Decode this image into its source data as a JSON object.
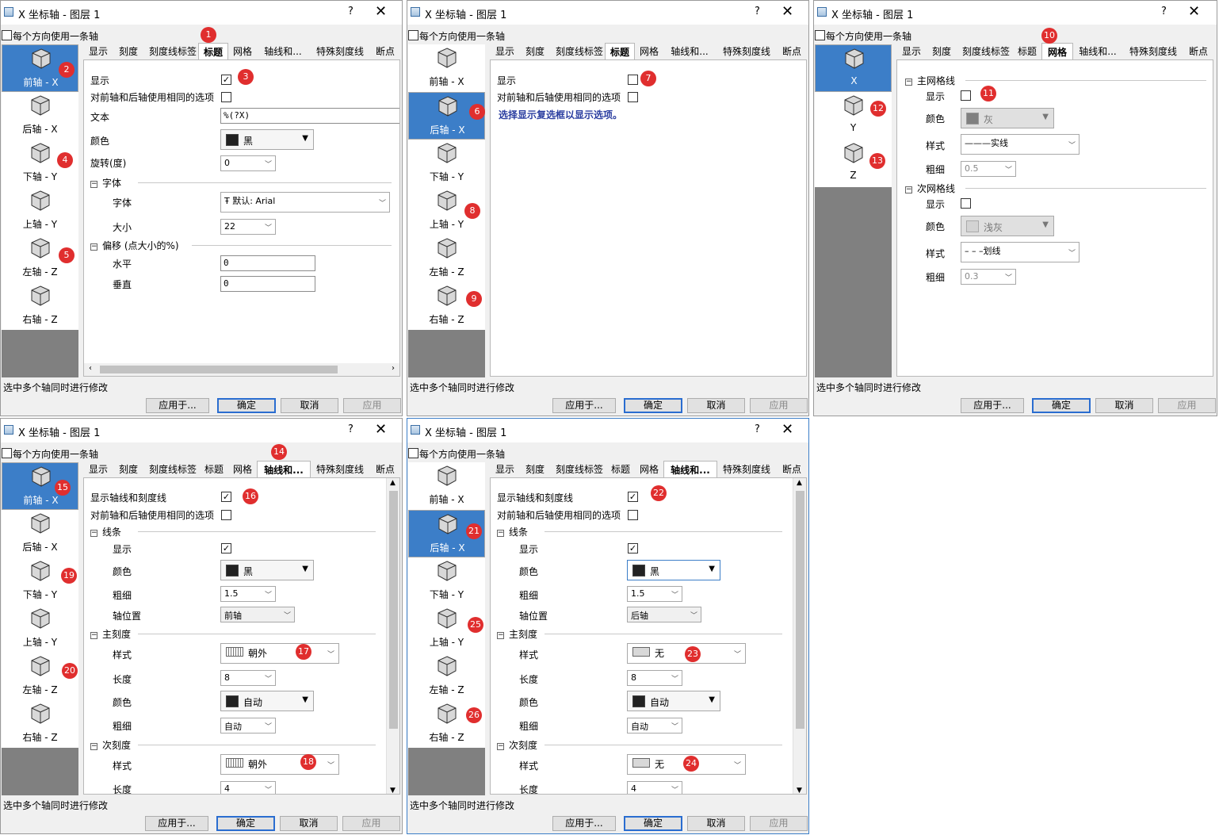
{
  "dialogs": [
    {
      "title": "X 坐标轴 - 图层 1",
      "help": "?",
      "close": "✕",
      "one_axis_label": "每个方向使用一条轴",
      "tabs": [
        "显示",
        "刻度",
        "刻度线标签",
        "标题",
        "网格",
        "轴线和...",
        "特殊刻度线",
        "断点"
      ],
      "active_tab": "标题",
      "axes": [
        "前轴 - X",
        "后轴 - X",
        "下轴 - Y",
        "上轴 - Y",
        "左轴 - Z",
        "右轴 - Z"
      ],
      "selected_axis": "前轴 - X",
      "fields": {
        "show": "显示",
        "same_opt": "对前轴和后轴使用相同的选项",
        "text": "文本",
        "text_value": "%(?X)",
        "color": "颜色",
        "color_value": "黑",
        "rotate": "旋转(度)",
        "rotate_value": "0",
        "font_section": "字体",
        "font": "字体",
        "font_value": "默认: Arial",
        "size": "大小",
        "size_value": "22",
        "offset_section": "偏移 (点大小的%)",
        "horizontal": "水平",
        "horizontal_value": "0",
        "vertical": "垂直",
        "vertical_value": "0"
      },
      "status": "选中多个轴同时进行修改",
      "buttons": {
        "apply_to": "应用于...",
        "ok": "确定",
        "cancel": "取消",
        "apply": "应用"
      }
    },
    {
      "title": "X 坐标轴 - 图层 1",
      "help": "?",
      "close": "✕",
      "one_axis_label": "每个方向使用一条轴",
      "tabs": [
        "显示",
        "刻度",
        "刻度线标签",
        "标题",
        "网格",
        "轴线和...",
        "特殊刻度线",
        "断点"
      ],
      "active_tab": "标题",
      "axes": [
        "前轴 - X",
        "后轴 - X",
        "下轴 - Y",
        "上轴 - Y",
        "左轴 - Z",
        "右轴 - Z"
      ],
      "selected_axis": "后轴 - X",
      "fields": {
        "show": "显示",
        "same_opt": "对前轴和后轴使用相同的选项",
        "hint": "选择显示复选框以显示选项。"
      },
      "status": "选中多个轴同时进行修改",
      "buttons": {
        "apply_to": "应用于...",
        "ok": "确定",
        "cancel": "取消",
        "apply": "应用"
      }
    },
    {
      "title": "X 坐标轴 - 图层 1",
      "help": "?",
      "close": "✕",
      "one_axis_label": "每个方向使用一条轴",
      "tabs": [
        "显示",
        "刻度",
        "刻度线标签",
        "标题",
        "网格",
        "轴线和...",
        "特殊刻度线",
        "断点"
      ],
      "active_tab": "网格",
      "axes": [
        "X",
        "Y",
        "Z"
      ],
      "selected_axis": "X",
      "fields": {
        "major_section": "主网格线",
        "show": "显示",
        "color": "颜色",
        "major_color": "灰",
        "style": "样式",
        "major_style": "———实线",
        "width": "粗细",
        "major_width": "0.5",
        "minor_section": "次网格线",
        "minor_color": "浅灰",
        "minor_style": "– – –划线",
        "minor_width": "0.3"
      },
      "status": "选中多个轴同时进行修改",
      "buttons": {
        "apply_to": "应用于...",
        "ok": "确定",
        "cancel": "取消",
        "apply": "应用"
      }
    },
    {
      "title": "X 坐标轴 - 图层 1",
      "help": "?",
      "close": "✕",
      "one_axis_label": "每个方向使用一条轴",
      "tabs": [
        "显示",
        "刻度",
        "刻度线标签",
        "标题",
        "网格",
        "轴线和...",
        "特殊刻度线",
        "断点"
      ],
      "active_tab": "轴线和...",
      "axes": [
        "前轴 - X",
        "后轴 - X",
        "下轴 - Y",
        "上轴 - Y",
        "左轴 - Z",
        "右轴 - Z"
      ],
      "selected_axis": "前轴 - X",
      "fields": {
        "show_axis": "显示轴线和刻度线",
        "same_opt": "对前轴和后轴使用相同的选项",
        "line_section": "线条",
        "show": "显示",
        "color": "颜色",
        "line_color": "黑",
        "width": "粗细",
        "line_width": "1.5",
        "axis_pos": "轴位置",
        "axis_pos_value": "前轴",
        "major_section": "主刻度",
        "style": "样式",
        "major_style": "朝外",
        "length": "长度",
        "major_length": "8",
        "major_color": "自动",
        "major_width": "自动",
        "minor_section": "次刻度",
        "minor_style": "朝外",
        "minor_length": "4"
      },
      "status": "选中多个轴同时进行修改",
      "buttons": {
        "apply_to": "应用于...",
        "ok": "确定",
        "cancel": "取消",
        "apply": "应用"
      }
    },
    {
      "title": "X 坐标轴 - 图层 1",
      "help": "?",
      "close": "✕",
      "one_axis_label": "每个方向使用一条轴",
      "tabs": [
        "显示",
        "刻度",
        "刻度线标签",
        "标题",
        "网格",
        "轴线和...",
        "特殊刻度线",
        "断点"
      ],
      "active_tab": "轴线和...",
      "axes": [
        "前轴 - X",
        "后轴 - X",
        "下轴 - Y",
        "上轴 - Y",
        "左轴 - Z",
        "右轴 - Z"
      ],
      "selected_axis": "后轴 - X",
      "fields": {
        "show_axis": "显示轴线和刻度线",
        "same_opt": "对前轴和后轴使用相同的选项",
        "line_section": "线条",
        "show": "显示",
        "color": "颜色",
        "line_color": "黑",
        "width": "粗细",
        "line_width": "1.5",
        "axis_pos": "轴位置",
        "axis_pos_value": "后轴",
        "major_section": "主刻度",
        "style": "样式",
        "major_style": "无",
        "length": "长度",
        "major_length": "8",
        "major_color": "自动",
        "major_width": "自动",
        "minor_section": "次刻度",
        "minor_style": "无",
        "minor_length": "4"
      },
      "status": "选中多个轴同时进行修改",
      "buttons": {
        "apply_to": "应用于...",
        "ok": "确定",
        "cancel": "取消",
        "apply": "应用"
      }
    }
  ],
  "badges": [
    "1",
    "2",
    "3",
    "4",
    "5",
    "6",
    "7",
    "8",
    "9",
    "10",
    "11",
    "12",
    "13",
    "14",
    "15",
    "16",
    "17",
    "18",
    "19",
    "20",
    "21",
    "22",
    "23",
    "24",
    "25",
    "26"
  ],
  "colors": {
    "accent": "#3c7ec8",
    "badge": "#e02e2e",
    "hint": "#2b3ea0",
    "default_button_border": "#2a6dd0"
  }
}
